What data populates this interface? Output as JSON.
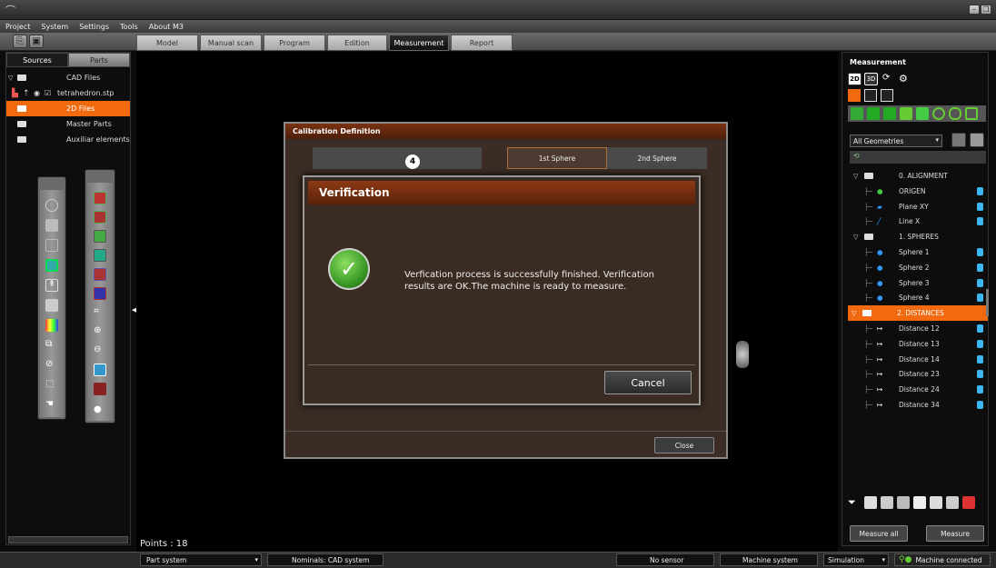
{
  "menu": {
    "items": [
      "Project",
      "System",
      "Settings",
      "Tools",
      "About M3"
    ]
  },
  "tabs": [
    {
      "label": "Model",
      "active": false
    },
    {
      "label": "Manual scan",
      "active": false
    },
    {
      "label": "Program",
      "active": false
    },
    {
      "label": "Edition",
      "active": false
    },
    {
      "label": "Measurement",
      "active": true
    },
    {
      "label": "Report",
      "active": false
    }
  ],
  "left_panel": {
    "tabs": [
      "Sources",
      "Parts"
    ],
    "active_tab": "Sources",
    "tree": [
      {
        "label": "CAD Files"
      },
      {
        "label": "tetrahedron.stp"
      },
      {
        "label": "2D Files",
        "selected": true
      },
      {
        "label": "Master Parts"
      },
      {
        "label": "Auxiliar elements"
      }
    ]
  },
  "viewport": {
    "points_label": "Points : 18"
  },
  "calibration_dialog": {
    "title": "Calibration Definition",
    "step_number": "4",
    "sphere_tabs": [
      "1st Sphere",
      "2nd Sphere"
    ],
    "close_label": "Close"
  },
  "verification_dialog": {
    "title": "Verification",
    "message_line1": "Verfication process is successfully finished. Verification",
    "message_line2": "results are OK.The machine is ready to measure.",
    "cancel_label": "Cancel"
  },
  "right_panel": {
    "title": "Measurement",
    "mode_2d": "2D",
    "mode_3d": "3D",
    "filter_value": "All Geometries",
    "tree": [
      {
        "label": "0. ALIGNMENT",
        "type": "group"
      },
      {
        "label": "ORIGEN",
        "type": "point"
      },
      {
        "label": "Plane XY",
        "type": "plane"
      },
      {
        "label": "Line X",
        "type": "line"
      },
      {
        "label": "1. SPHERES",
        "type": "group"
      },
      {
        "label": "Sphere 1",
        "type": "sphere"
      },
      {
        "label": "Sphere 2",
        "type": "sphere"
      },
      {
        "label": "Sphere 3",
        "type": "sphere"
      },
      {
        "label": "Sphere 4",
        "type": "sphere"
      },
      {
        "label": "2. DISTANCES",
        "type": "group",
        "selected": true
      },
      {
        "label": "Distance 12",
        "type": "distance"
      },
      {
        "label": "Distance 13",
        "type": "distance"
      },
      {
        "label": "Distance 14",
        "type": "distance"
      },
      {
        "label": "Distance 23",
        "type": "distance"
      },
      {
        "label": "Distance 24",
        "type": "distance"
      },
      {
        "label": "Distance 34",
        "type": "distance"
      }
    ],
    "measure_all_label": "Measure all",
    "measure_label": "Measure"
  },
  "status_bar": {
    "part_system": "Part system",
    "nominals": "Nominals: CAD system",
    "sensor": "No sensor",
    "machine_system": "Machine system",
    "mode": "Simulation",
    "connection": "Machine connected"
  },
  "colors": {
    "accent": "#f26a10",
    "title_brown": "#7a3212",
    "status_dot": "#3cb7f3",
    "ok_green": "#3a9a28"
  }
}
